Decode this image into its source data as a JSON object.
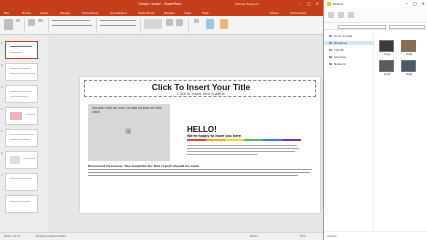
{
  "ppt": {
    "title": "Design Helper - PowerPoint",
    "user": "Chang Heng Lin",
    "window_controls": [
      "–",
      "□",
      "✕"
    ],
    "tabs": [
      "File",
      "Home",
      "Insert",
      "Design",
      "Transitions",
      "Animations",
      "Slide Show",
      "Review",
      "View",
      "Help",
      "Share",
      "Comments"
    ],
    "slide": {
      "title": "Click To Insert Your Title",
      "subtitle": "Click To Insert Your Subtitle",
      "image_placeholder": "Double-click on icon to add picture on this slide.",
      "hello": "HELLO!",
      "welcome": "We're happy to have you here",
      "body": "Document Overview: The template for this report should be used."
    },
    "thumb_numbers": [
      "1",
      "2",
      "3",
      "4",
      "5",
      "6",
      "7"
    ],
    "status": {
      "slide": "Slide 1 of 11",
      "lang": "English (United States)",
      "notes": "Notes",
      "zoom": "67%"
    },
    "accent": "#c43e1c",
    "color_bar": [
      "#e34234",
      "#f5a623",
      "#f8d32a",
      "#5cb85c",
      "#2f80ed",
      "#6a3fa0"
    ]
  },
  "explorer": {
    "title": "Photos",
    "nav": [
      "Quick access",
      "OneDrive",
      "This PC",
      "Libraries",
      "Network"
    ],
    "files": [
      {
        "name": "img1"
      },
      {
        "name": "img2"
      },
      {
        "name": "img3"
      },
      {
        "name": "img4"
      }
    ],
    "status": "4 items"
  }
}
